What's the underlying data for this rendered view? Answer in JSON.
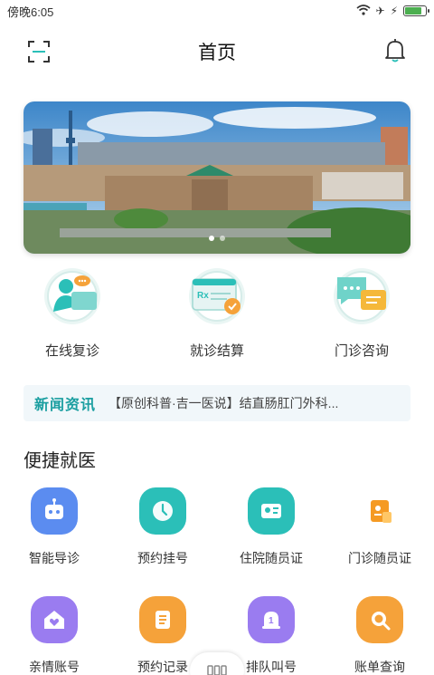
{
  "status_bar": {
    "time": "傍晚6:05"
  },
  "header": {
    "title": "首页"
  },
  "main_services": [
    {
      "label": "在线复诊",
      "icon": "online-revisit-icon"
    },
    {
      "label": "就诊结算",
      "icon": "settlement-icon"
    },
    {
      "label": "门诊咨询",
      "icon": "consult-icon"
    }
  ],
  "news": {
    "tag": "新闻资讯",
    "text": "【原创科普·吉一医说】结直肠肛门外科..."
  },
  "quick": {
    "title": "便捷就医",
    "row1": [
      {
        "label": "智能导诊",
        "icon": "robot-icon",
        "color": "#5b8cf0"
      },
      {
        "label": "预约挂号",
        "icon": "clock-icon",
        "color": "#2bbfb8"
      },
      {
        "label": "住院随员证",
        "icon": "id-card-icon",
        "color": "#2bbfb8"
      },
      {
        "label": "门诊随员证",
        "icon": "badge-icon",
        "color": "#f59a23"
      }
    ],
    "row2": [
      {
        "label": "亲情账号",
        "icon": "home-heart-icon",
        "color": "#9a7cf0"
      },
      {
        "label": "预约记录",
        "icon": "record-icon",
        "color": "#f5a23a"
      },
      {
        "label": "排队叫号",
        "icon": "queue-bell-icon",
        "color": "#9a7cf0"
      },
      {
        "label": "账单查询",
        "icon": "search-bill-icon",
        "color": "#f5a23a"
      }
    ]
  }
}
